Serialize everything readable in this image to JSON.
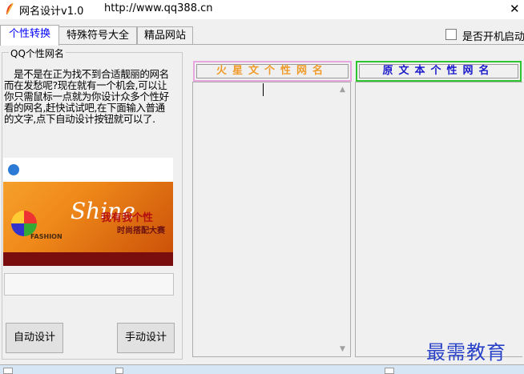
{
  "window": {
    "title": "网名设计v1.0",
    "url": "http://www.qq388.cn",
    "close_symbol": "✕"
  },
  "tabs": [
    {
      "label": "个性转换",
      "active": true
    },
    {
      "label": "特殊符号大全",
      "active": false
    },
    {
      "label": "精品网站",
      "active": false
    }
  ],
  "autostart": {
    "label": "是否开机启动",
    "checked": false
  },
  "left_panel": {
    "group_title": "QQ个性网名",
    "intro": "　是不是在正为找不到合适靓丽的网名而在发愁呢?现在就有一个机会,可以让你只需鼠标一点就为你设计众多个性好看的网名,赶快试试吧,在下面输入普通的文字,点下自动设计按钮就可以了.",
    "banner": {
      "brand": "Shine",
      "slogan": "我有我个性",
      "sub": "时尚搭配大赛",
      "fashion": "FASHION"
    },
    "input_value": "",
    "auto_button": "自动设计",
    "manual_button": "手动设计"
  },
  "columns": {
    "martian": {
      "header": "火星文个性网名",
      "color": "#ef9b2a",
      "border": "#e8a6e0"
    },
    "original": {
      "header": "原文本个性网名",
      "color": "#1a1acb",
      "border": "#2fc52f"
    }
  },
  "watermark": "最需教育",
  "icons": {
    "app": "feather-icon",
    "scroll_up": "chevron-up-icon",
    "scroll_down": "chevron-down-icon"
  }
}
